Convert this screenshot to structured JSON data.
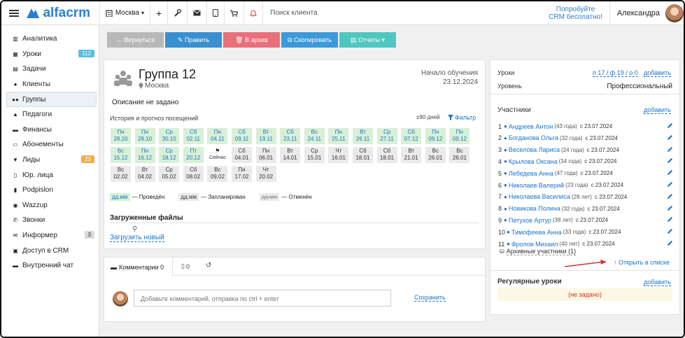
{
  "app": {
    "logo_text": "alfacrm"
  },
  "topbar": {
    "branch": "Москва",
    "search_label": "Поиск клиента",
    "try_line1": "Попробуйте",
    "try_line2": "CRM бесплатно!",
    "user_name": "Александра"
  },
  "sidebar": {
    "items": [
      {
        "label": "Аналитика",
        "icon": "chart-icon"
      },
      {
        "label": "Уроки",
        "icon": "calendar-icon",
        "badge": "112",
        "badge_color": "#5bc0de"
      },
      {
        "label": "Задачи",
        "icon": "clipboard-icon"
      },
      {
        "label": "Клиенты",
        "icon": "user-icon"
      },
      {
        "label": "Группы",
        "icon": "users-icon",
        "active": true
      },
      {
        "label": "Педагоги",
        "icon": "graduation-cap-icon"
      },
      {
        "label": "Финансы",
        "icon": "money-icon"
      },
      {
        "label": "Абонементы",
        "icon": "ticket-icon"
      },
      {
        "label": "Лиды",
        "icon": "funnel-icon",
        "badge": "23",
        "badge_color": "#f0ad4e"
      },
      {
        "label": "Юр. лица",
        "icon": "building-icon"
      },
      {
        "label": "Podpislon",
        "icon": "document-icon"
      },
      {
        "label": "Wazzup",
        "icon": "chat-icon"
      },
      {
        "label": "Звонки",
        "icon": "phone-icon"
      },
      {
        "label": "Информер",
        "icon": "envelope-icon",
        "badge": "3",
        "badge_color": "#d9d9d9"
      },
      {
        "label": "Доступ в CRM",
        "icon": "lock-icon"
      },
      {
        "label": "Внутренний чат",
        "icon": "chat-list-icon"
      }
    ]
  },
  "actions": {
    "back": "← Вернуться",
    "edit": "✎ Править",
    "archive": "🗑 В архив",
    "copy": "⧉ Скопировать",
    "reports": "▤ Отчеты ▾",
    "colors": {
      "back": "#b8b8b8",
      "edit": "#3a8fd0",
      "archive": "#e8707a",
      "copy": "#3d9ad8",
      "reports": "#4fc7c0"
    }
  },
  "group": {
    "title": "Группа 12",
    "location": "Москва",
    "start_label": "Начало обучения",
    "start_date": "23.12.2024",
    "description": "Описание не задано",
    "history_label": "История и прогноз посещений",
    "days_range": "±90 дней",
    "filter": "Фильтр",
    "legend": [
      {
        "chip": "дд.мм",
        "text": "— Проведён",
        "kind": "past"
      },
      {
        "chip": "дд.мм",
        "text": "— Запланирован",
        "kind": "plan"
      },
      {
        "chip": "дд.мм",
        "text": "— Отменён",
        "kind": "cancel"
      }
    ],
    "days": [
      {
        "wd": "Пн",
        "d": "28.10",
        "k": "past"
      },
      {
        "wd": "Пн",
        "d": "28.10",
        "k": "past"
      },
      {
        "wd": "Ср",
        "d": "30.10",
        "k": "past"
      },
      {
        "wd": "Сб",
        "d": "02.11",
        "k": "past"
      },
      {
        "wd": "Пн",
        "d": "04.11",
        "k": "past"
      },
      {
        "wd": "Сб",
        "d": "09.11",
        "k": "past"
      },
      {
        "wd": "Вт",
        "d": "19.11",
        "k": "past"
      },
      {
        "wd": "Сб",
        "d": "23.11",
        "k": "past"
      },
      {
        "wd": "Вс",
        "d": "24.11",
        "k": "past"
      },
      {
        "wd": "Пн",
        "d": "25.11",
        "k": "past"
      },
      {
        "wd": "Вт",
        "d": "26.11",
        "k": "past"
      },
      {
        "wd": "Ср",
        "d": "27.11",
        "k": "past"
      },
      {
        "wd": "Сб",
        "d": "07.12",
        "k": "past"
      },
      {
        "wd": "Пн",
        "d": "09.12",
        "k": "past"
      },
      {
        "wd": "Пн",
        "d": "09.12",
        "k": "past"
      },
      {
        "wd": "Вс",
        "d": "15.12",
        "k": "past"
      },
      {
        "wd": "Пн",
        "d": "16.12",
        "k": "past"
      },
      {
        "wd": "Ср",
        "d": "18.12",
        "k": "past"
      },
      {
        "wd": "Пт",
        "d": "20.12",
        "k": "past"
      },
      {
        "wd": "",
        "d": "Сейчас",
        "k": "today"
      },
      {
        "wd": "Сб",
        "d": "04.01",
        "k": "plan"
      },
      {
        "wd": "Пн",
        "d": "06.01",
        "k": "plan"
      },
      {
        "wd": "Вт",
        "d": "14.01",
        "k": "plan"
      },
      {
        "wd": "Ср",
        "d": "15.01",
        "k": "plan"
      },
      {
        "wd": "Чт",
        "d": "16.01",
        "k": "plan"
      },
      {
        "wd": "Сб",
        "d": "18.01",
        "k": "plan"
      },
      {
        "wd": "Сб",
        "d": "18.01",
        "k": "plan"
      },
      {
        "wd": "Вт",
        "d": "21.01",
        "k": "plan"
      },
      {
        "wd": "Вс",
        "d": "26.01",
        "k": "plan"
      },
      {
        "wd": "Вс",
        "d": "26.01",
        "k": "plan"
      },
      {
        "wd": "Вс",
        "d": "02.02",
        "k": "plan"
      },
      {
        "wd": "Вт",
        "d": "04.02",
        "k": "plan"
      },
      {
        "wd": "Ср",
        "d": "05.02",
        "k": "plan"
      },
      {
        "wd": "Сб",
        "d": "08.02",
        "k": "plan"
      },
      {
        "wd": "Вс",
        "d": "09.02",
        "k": "plan"
      },
      {
        "wd": "Пн",
        "d": "17.02",
        "k": "plan"
      },
      {
        "wd": "Чт",
        "d": "20.02",
        "k": "plan"
      }
    ],
    "files_label": "Загруженные файлы",
    "upload": "Загрузить новый"
  },
  "comments": {
    "tab_label": "Комментарии 0",
    "tab2_count": "0",
    "placeholder": "Добавьте комментарий, отправка по ctrl + enter",
    "save": "Сохранить"
  },
  "info": {
    "lessons_label": "Уроки",
    "lessons_value": "п 17 / ф 19 / о 0",
    "add": "добавить",
    "level_label": "Уровень",
    "level_value": "Профессиональный",
    "participants_label": "Участники",
    "archive_link": "Архивные участники (1)",
    "open_list": "Открыть в списке",
    "regular_label": "Регулярные уроки",
    "regular_value": "(не задано)",
    "members": [
      {
        "n": "1",
        "name": "Андреев Антон",
        "age": "(43 года)",
        "date": "с 23.07.2024"
      },
      {
        "n": "2",
        "name": "Богданова Ольга",
        "age": "(32 года)",
        "date": "с 23.07.2024"
      },
      {
        "n": "3",
        "name": "Веселова Лариса",
        "age": "(24 года)",
        "date": "с 23.07.2024"
      },
      {
        "n": "4",
        "name": "Крылова Оксана",
        "age": "(34 года)",
        "date": "с 23.07.2024"
      },
      {
        "n": "5",
        "name": "Лебедева Анна",
        "age": "(47 года)",
        "date": "с 23.07.2024"
      },
      {
        "n": "6",
        "name": "Николаев Валерий",
        "age": "(23 года)",
        "date": "с 23.07.2024"
      },
      {
        "n": "7",
        "name": "Николаева Василиса",
        "age": "(28 лет)",
        "date": "с 23.07.2024"
      },
      {
        "n": "8",
        "name": "Новикова Полина",
        "age": "(32 года)",
        "date": "с 23.07.2024"
      },
      {
        "n": "9",
        "name": "Петухов Артур",
        "age": "(38 лет)",
        "date": "с 23.07.2024"
      },
      {
        "n": "10",
        "name": "Тимофеева Анна",
        "age": "(33 года)",
        "date": "с 23.07.2024"
      },
      {
        "n": "11",
        "name": "Фролов Михаил",
        "age": "(40 лет)",
        "date": "с 23.07.2024"
      }
    ]
  }
}
